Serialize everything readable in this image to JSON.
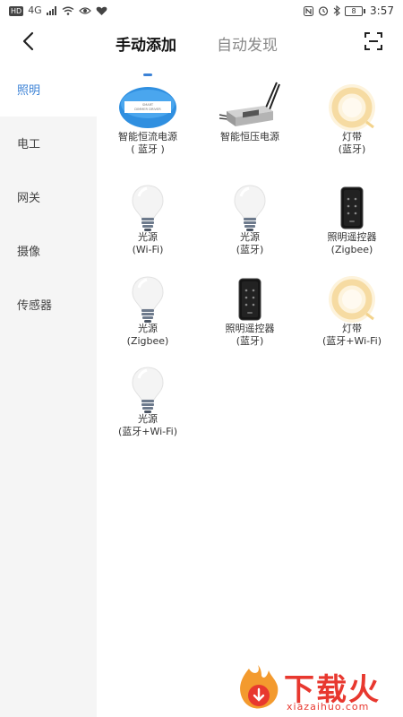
{
  "status_bar": {
    "hd": "HD",
    "network": "4G",
    "time": "3:57",
    "battery": "8"
  },
  "header": {
    "tabs": [
      {
        "label": "手动添加",
        "active": true
      },
      {
        "label": "自动发现",
        "active": false
      }
    ],
    "accent_color": "#3b82d6"
  },
  "sidebar": {
    "items": [
      {
        "label": "照明",
        "active": true
      },
      {
        "label": "电工",
        "active": false
      },
      {
        "label": "网关",
        "active": false
      },
      {
        "label": "摄像",
        "active": false
      },
      {
        "label": "传感器",
        "active": false
      }
    ]
  },
  "devices": [
    {
      "label": "智能恒流电源\n( 蓝牙 )",
      "icon": "constant-current-driver-icon",
      "box_text": "SMART\nDIMMER DRIVER"
    },
    {
      "label": "智能恒压电源",
      "icon": "constant-voltage-driver-icon"
    },
    {
      "label": "灯带\n(蓝牙)",
      "icon": "light-strip-icon"
    },
    {
      "label": "光源\n(Wi-Fi)",
      "icon": "bulb-icon"
    },
    {
      "label": "光源\n(蓝牙)",
      "icon": "bulb-icon"
    },
    {
      "label": "照明遥控器\n(Zigbee)",
      "icon": "remote-control-icon"
    },
    {
      "label": "光源\n(Zigbee)",
      "icon": "bulb-icon"
    },
    {
      "label": "照明遥控器\n(蓝牙)",
      "icon": "remote-control-icon"
    },
    {
      "label": "灯带\n(蓝牙+Wi-Fi)",
      "icon": "light-strip-icon"
    },
    {
      "label": "光源\n(蓝牙+Wi-Fi)",
      "icon": "bulb-icon"
    }
  ],
  "watermark": {
    "title": "下载火",
    "subtitle": "xiazaihuo.com"
  }
}
